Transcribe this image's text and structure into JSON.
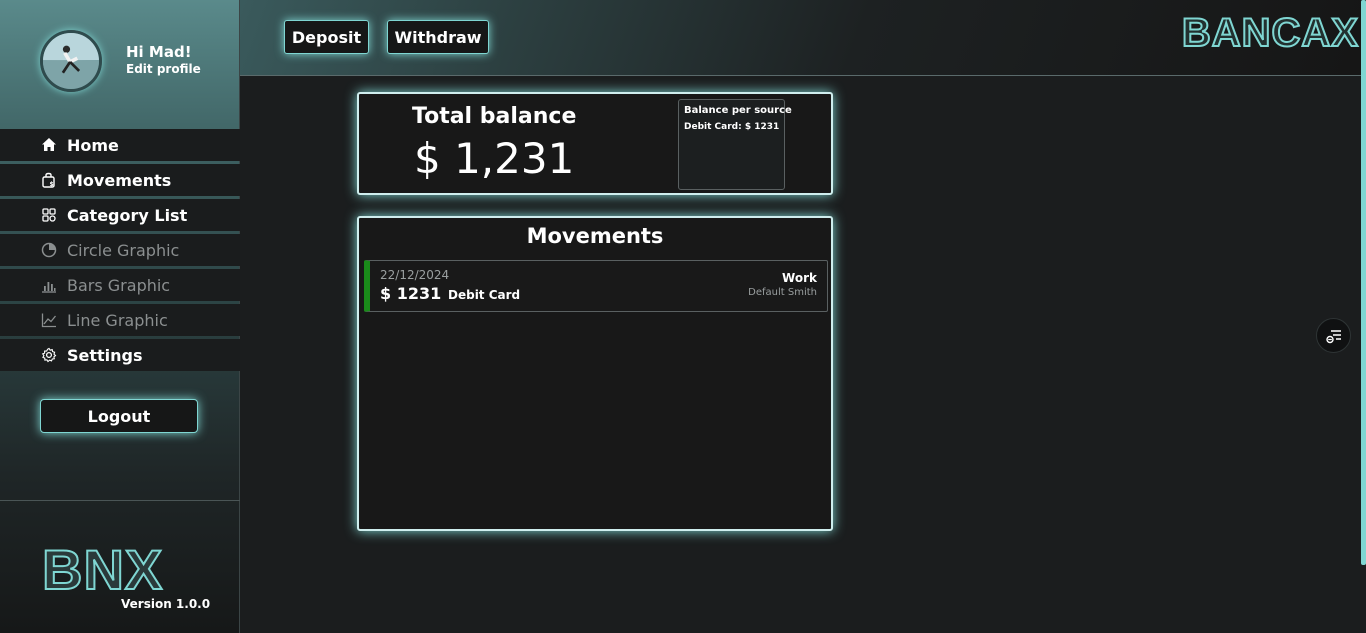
{
  "profile": {
    "greeting": "Hi Mad!",
    "edit_label": "Edit profile"
  },
  "nav": {
    "items": [
      {
        "label": "Home",
        "icon": "home-icon",
        "enabled": true
      },
      {
        "label": "Movements",
        "icon": "wallet-icon",
        "enabled": true
      },
      {
        "label": "Category List",
        "icon": "grid-icon",
        "enabled": true
      },
      {
        "label": "Circle Graphic",
        "icon": "pie-chart-icon",
        "enabled": false
      },
      {
        "label": "Bars Graphic",
        "icon": "bar-chart-icon",
        "enabled": false
      },
      {
        "label": "Line Graphic",
        "icon": "line-chart-icon",
        "enabled": false
      },
      {
        "label": "Settings",
        "icon": "gear-icon",
        "enabled": true
      }
    ]
  },
  "logout_label": "Logout",
  "footer": {
    "logo": "BNX",
    "version": "Version 1.0.0"
  },
  "toolbar": {
    "deposit_label": "Deposit",
    "withdraw_label": "Withdraw",
    "brand": "BANCAX"
  },
  "balance": {
    "label": "Total balance",
    "value": "$ 1,231",
    "per_source_title": "Balance per source",
    "sources": [
      "Debit Card: $ 1231"
    ]
  },
  "movements": {
    "title": "Movements",
    "rows": [
      {
        "date": "22/12/2024",
        "amount": "$ 1231",
        "source": "Debit Card",
        "category": "Work",
        "user": "Default Smith",
        "type_color": "#1a8a1a"
      }
    ]
  },
  "colors": {
    "accent": "#7fd6d2",
    "income": "#1a8a1a",
    "panel": "#181818"
  }
}
